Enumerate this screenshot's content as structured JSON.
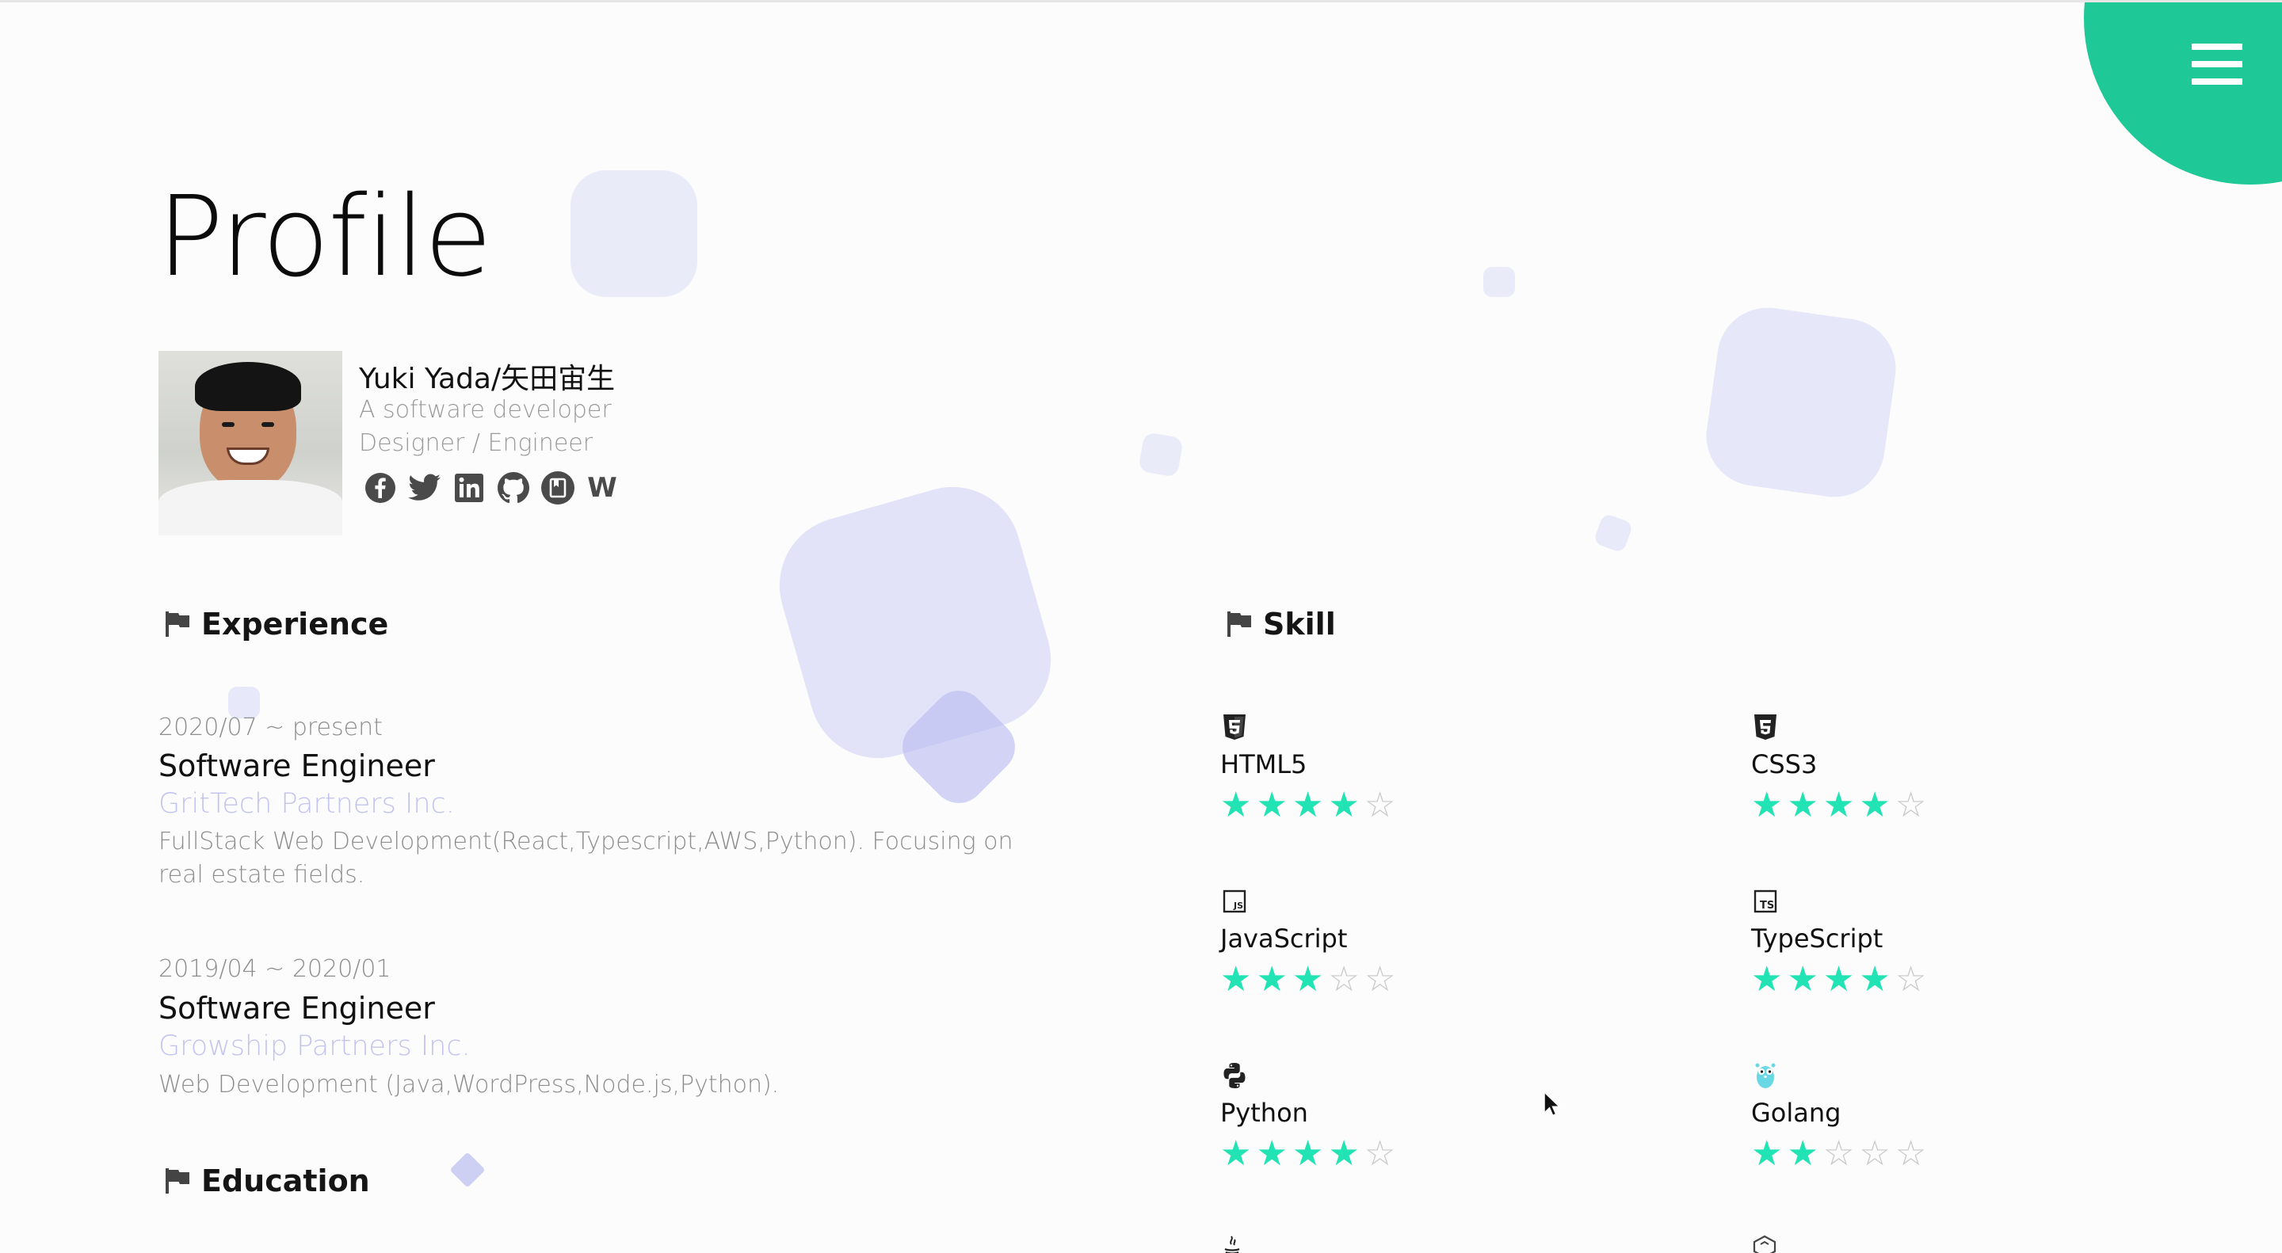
{
  "page": {
    "title": "Profile",
    "accent_color": "#1ec997",
    "star_color": "#22e3b3",
    "link_color": "#c2c3ee"
  },
  "menu": {
    "icon": "hamburger-icon"
  },
  "profile": {
    "name": "Yuki Yada/矢田宙生",
    "tagline": "A software developer",
    "roles": "Designer / Engineer",
    "socials": [
      {
        "icon": "facebook-icon"
      },
      {
        "icon": "twitter-icon"
      },
      {
        "icon": "linkedin-icon"
      },
      {
        "icon": "github-icon"
      },
      {
        "icon": "blog-icon"
      },
      {
        "icon": "wantedly-icon",
        "glyph": "W"
      }
    ]
  },
  "experience": {
    "heading": "Experience",
    "items": [
      {
        "date": "2020/07 ~ present",
        "role": "Software Engineer",
        "company": "GritTech Partners Inc.",
        "description": "FullStack Web Development(React,Typescript,AWS,Python). Focusing on real estate fields."
      },
      {
        "date": "2019/04 ~ 2020/01",
        "role": "Software Engineer",
        "company": "Growship Partners Inc.",
        "description": "Web Development (Java,WordPress,Node.js,Python)."
      }
    ]
  },
  "education": {
    "heading": "Education"
  },
  "skill": {
    "heading": "Skill",
    "max_rating": 5,
    "items": [
      {
        "name": "HTML5",
        "rating": 4,
        "icon": "html5-icon"
      },
      {
        "name": "CSS3",
        "rating": 4,
        "icon": "css3-icon"
      },
      {
        "name": "JavaScript",
        "rating": 3,
        "icon": "javascript-icon"
      },
      {
        "name": "TypeScript",
        "rating": 4,
        "icon": "typescript-icon"
      },
      {
        "name": "Python",
        "rating": 4,
        "icon": "python-icon"
      },
      {
        "name": "Golang",
        "rating": 2,
        "icon": "golang-icon"
      }
    ]
  }
}
